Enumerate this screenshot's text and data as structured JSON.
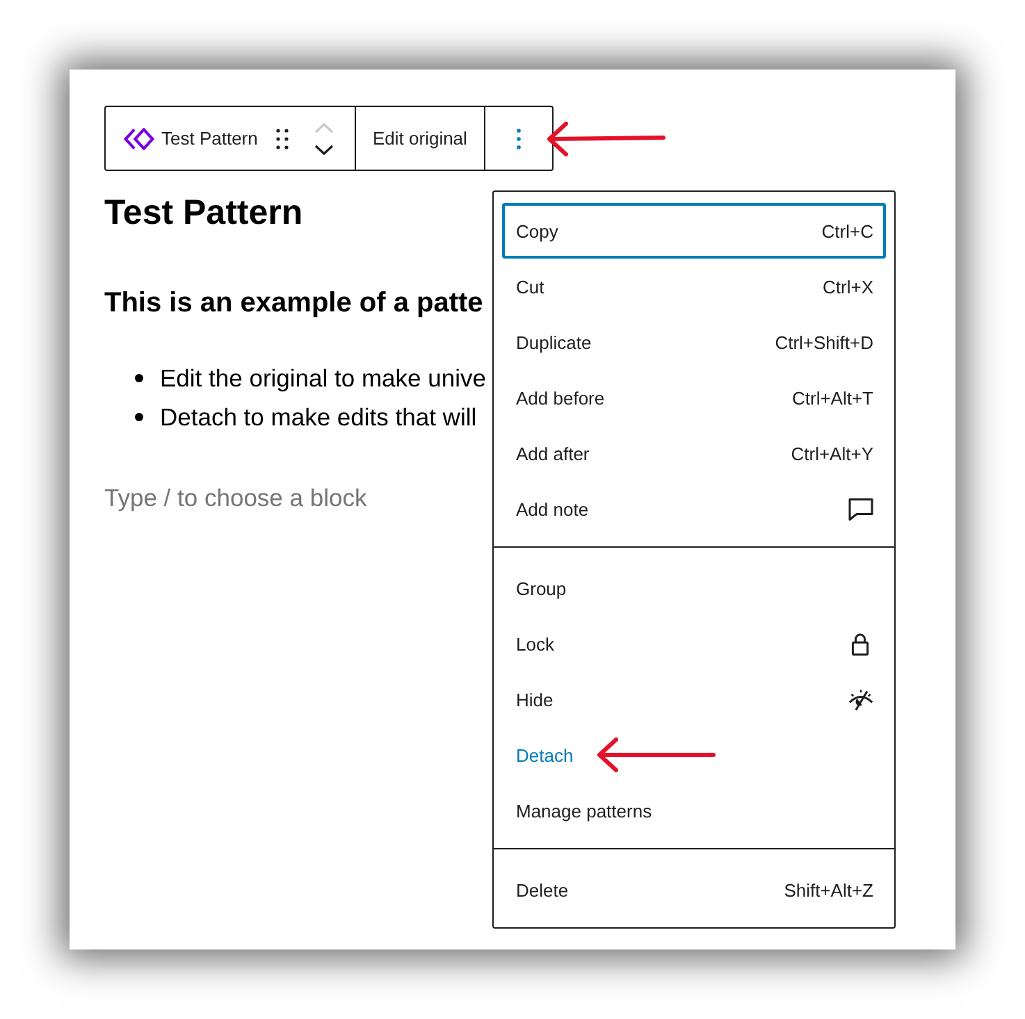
{
  "toolbar": {
    "pattern_label": "Test Pattern",
    "move_up_disabled": true,
    "move_down_disabled": false,
    "edit_button": "Edit original",
    "more_expanded": true,
    "more_annotated": true
  },
  "content": {
    "heading": "Test Pattern",
    "lead": "This is an example of a patte",
    "bullets": [
      "Edit the original to make unive",
      "Detach to make edits that will"
    ],
    "placeholder": "Type / to choose a block"
  },
  "menu": {
    "groups": [
      {
        "items": [
          {
            "label": "Copy",
            "kind": "shortcut",
            "shortcut": "Ctrl+C",
            "selected": true,
            "hovered": false,
            "annotated": false
          },
          {
            "label": "Cut",
            "kind": "shortcut",
            "shortcut": "Ctrl+X",
            "selected": false,
            "hovered": false,
            "annotated": false
          },
          {
            "label": "Duplicate",
            "kind": "shortcut",
            "shortcut": "Ctrl+Shift+D",
            "selected": false,
            "hovered": false,
            "annotated": false
          },
          {
            "label": "Add before",
            "kind": "shortcut",
            "shortcut": "Ctrl+Alt+T",
            "selected": false,
            "hovered": false,
            "annotated": false
          },
          {
            "label": "Add after",
            "kind": "shortcut",
            "shortcut": "Ctrl+Alt+Y",
            "selected": false,
            "hovered": false,
            "annotated": false
          },
          {
            "label": "Add note",
            "kind": "note",
            "selected": false,
            "hovered": false,
            "annotated": false
          }
        ]
      },
      {
        "items": [
          {
            "label": "Group",
            "kind": "plain",
            "selected": false,
            "hovered": false,
            "annotated": false
          },
          {
            "label": "Lock",
            "kind": "lock",
            "selected": false,
            "hovered": false,
            "annotated": false
          },
          {
            "label": "Hide",
            "kind": "hide",
            "selected": false,
            "hovered": false,
            "annotated": false
          },
          {
            "label": "Detach",
            "kind": "plain",
            "selected": false,
            "hovered": true,
            "annotated": true
          },
          {
            "label": "Manage patterns",
            "kind": "plain",
            "selected": false,
            "hovered": false,
            "annotated": false
          }
        ]
      },
      {
        "items": [
          {
            "label": "Delete",
            "kind": "shortcut",
            "shortcut": "Shift+Alt+Z",
            "selected": false,
            "hovered": false,
            "annotated": false
          }
        ]
      }
    ]
  }
}
